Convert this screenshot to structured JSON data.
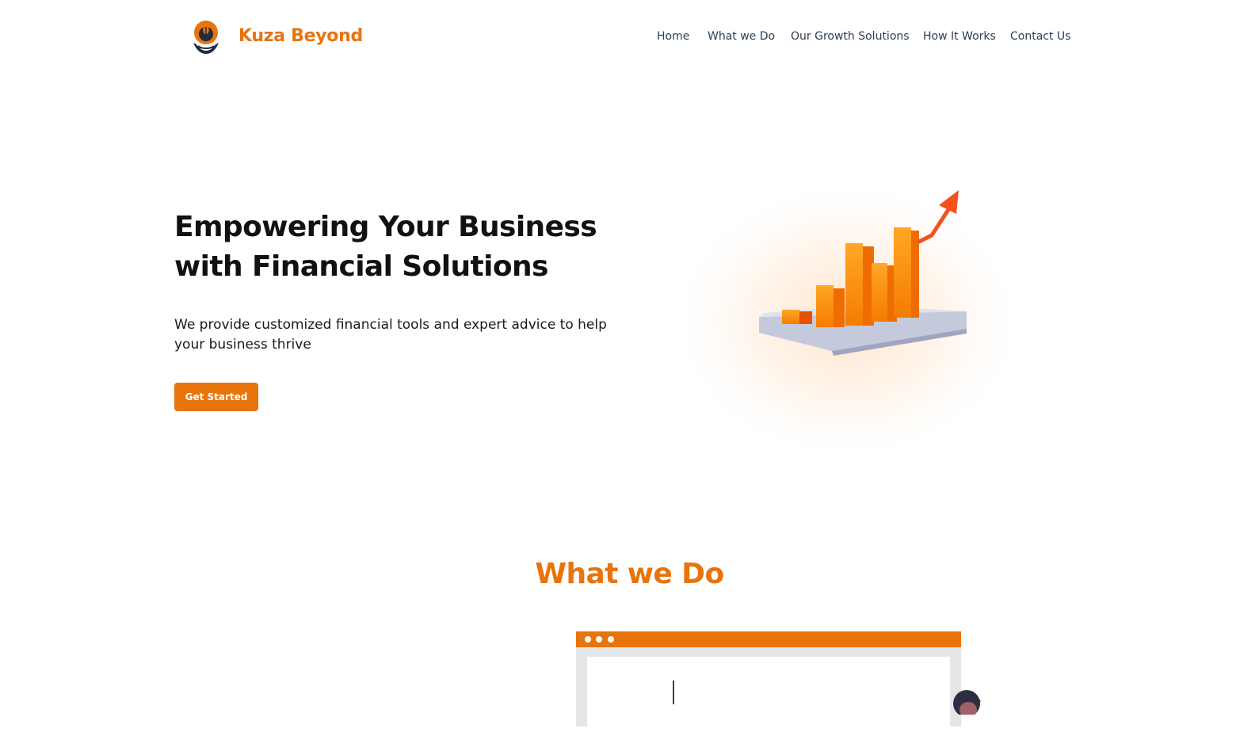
{
  "header": {
    "brand": "Kuza Beyond",
    "logo_icon": "leaf-in-hands-icon",
    "nav": [
      {
        "label": "Home"
      },
      {
        "label": "What we Do"
      },
      {
        "label": "Our Growth Solutions"
      },
      {
        "label": "How It Works"
      },
      {
        "label": "Contact Us"
      }
    ]
  },
  "hero": {
    "title": "Empowering Your Business with Financial Solutions",
    "subtitle": "We provide customized financial tools and expert advice to help your business thrive",
    "cta_label": "Get Started",
    "illustration_icon": "growth-bar-chart-illustration"
  },
  "what_we_do": {
    "title": "What we Do",
    "illustration_icon": "browser-window-illustration"
  },
  "colors": {
    "accent": "#e8740c",
    "text_dark": "#111111",
    "nav_text": "#2c3e50"
  }
}
